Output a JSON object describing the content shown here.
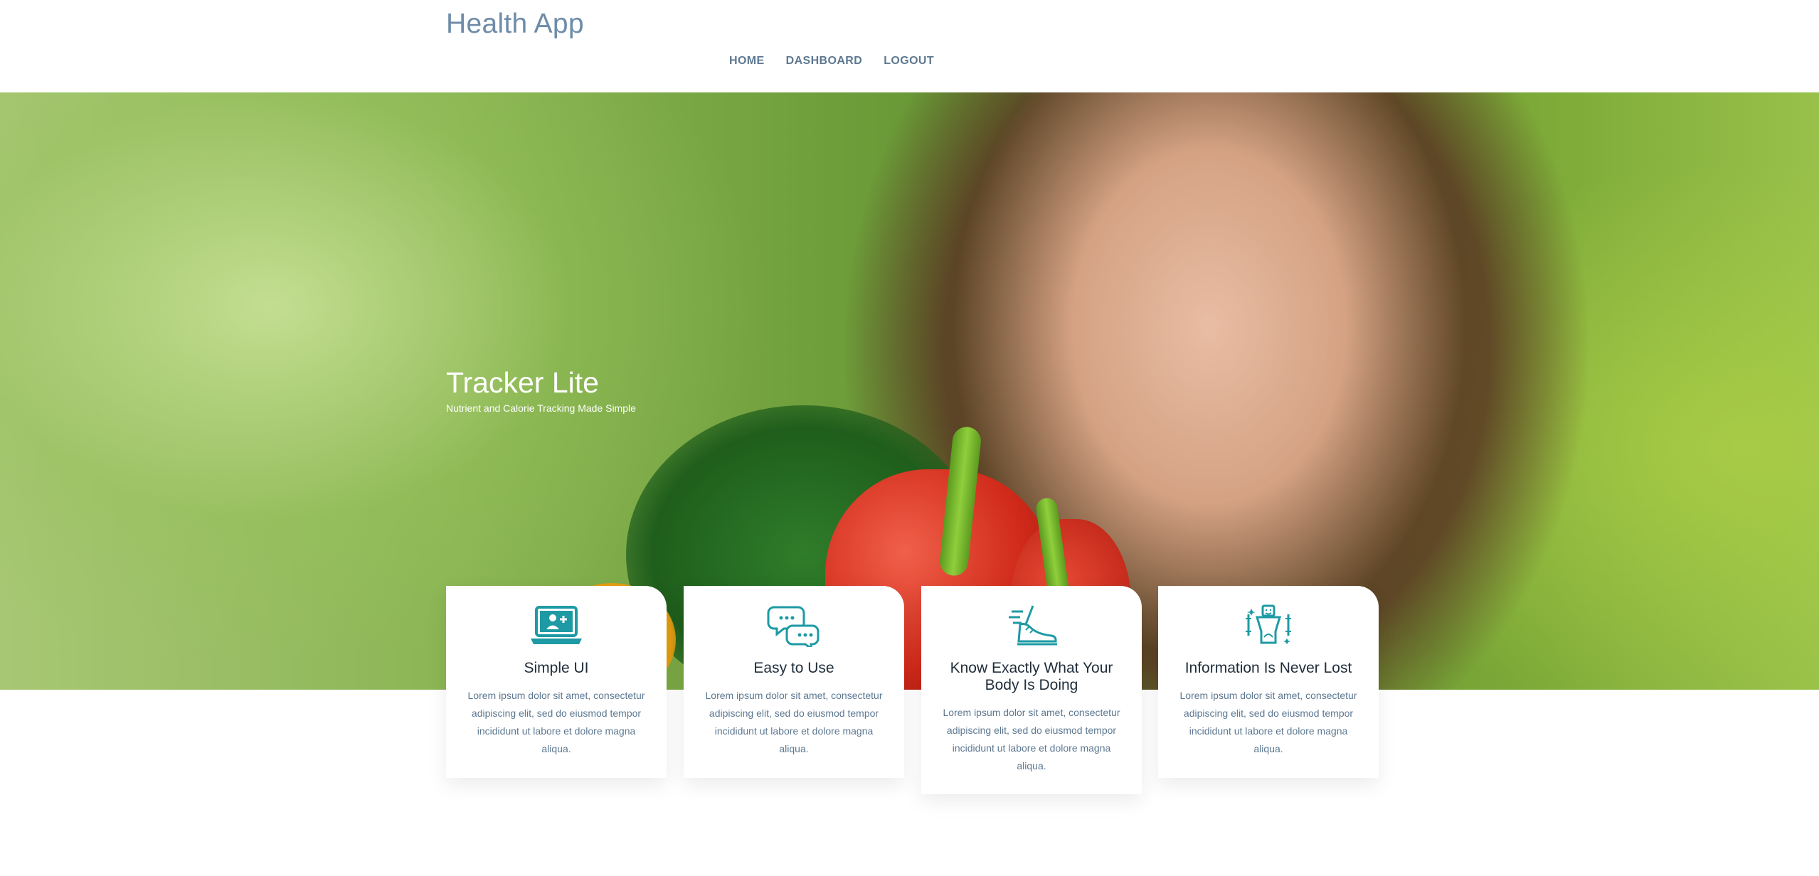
{
  "header": {
    "brand": "Health App",
    "nav": [
      {
        "label": "HOME"
      },
      {
        "label": "DASHBOARD"
      },
      {
        "label": "LOGOUT"
      }
    ]
  },
  "hero": {
    "title": "Tracker Lite",
    "subtitle": "Nutrient and Calorie Tracking Made Simple"
  },
  "features": [
    {
      "icon": "laptop-user-icon",
      "title": "Simple UI",
      "text": "Lorem ipsum dolor sit amet, consectetur adipiscing elit, sed do eiusmod tempor incididunt ut labore et dolore magna aliqua."
    },
    {
      "icon": "chat-bubbles-icon",
      "title": "Easy to Use",
      "text": "Lorem ipsum dolor sit amet, consectetur adipiscing elit, sed do eiusmod tempor incididunt ut labore et dolore magna aliqua."
    },
    {
      "icon": "running-shoe-icon",
      "title": "Know Exactly What Your Body Is Doing",
      "text": "Lorem ipsum dolor sit amet, consectetur adipiscing elit, sed do eiusmod tempor incididunt ut labore et dolore magna aliqua."
    },
    {
      "icon": "body-measure-icon",
      "title": "Information Is Never Lost",
      "text": "Lorem ipsum dolor sit amet, consectetur adipiscing elit, sed do eiusmod tempor incididunt ut labore et dolore magna aliqua."
    }
  ],
  "colors": {
    "brand": "#6e8ca8",
    "nav": "#5d7891",
    "icon_teal": "#1e9aa4",
    "heading": "#1f2d3a"
  }
}
